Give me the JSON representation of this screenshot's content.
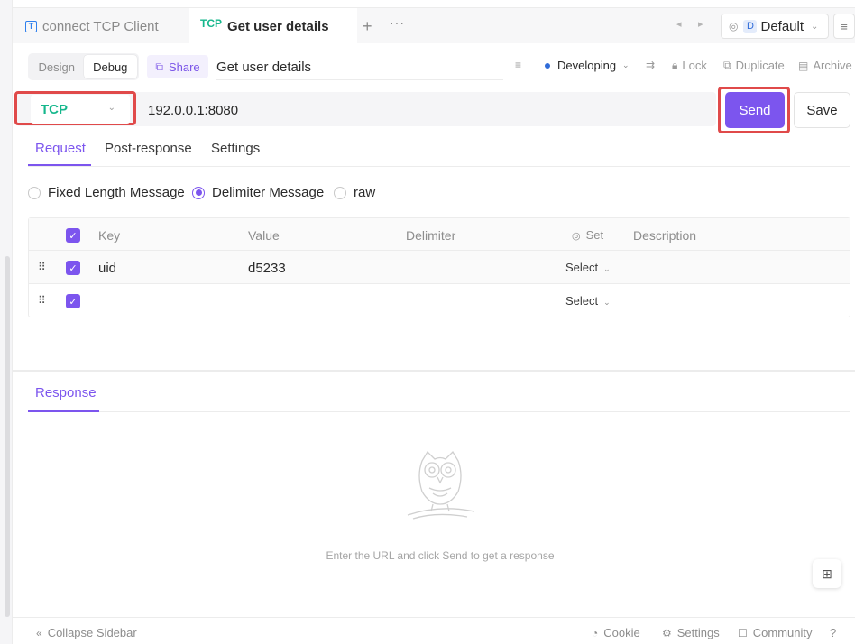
{
  "tabs": [
    {
      "label": "connect TCP Client",
      "icon": "t-icon"
    },
    {
      "tag": "TCP",
      "label": "Get user details"
    }
  ],
  "tabbar": {
    "add": "+",
    "more": "···",
    "prev": "◂",
    "next": "▸"
  },
  "environment": {
    "badge": "D",
    "label": "Default"
  },
  "mode": {
    "design": "Design",
    "debug": "Debug"
  },
  "share_label": "Share",
  "request_name": "Get user details",
  "toolbar": {
    "status": "Developing",
    "lock": "Lock",
    "duplicate": "Duplicate",
    "archive": "Archive"
  },
  "method": "TCP",
  "url": "192.0.0.1:8080",
  "send_label": "Send",
  "save_label": "Save",
  "request_tabs": [
    "Request",
    "Post-response",
    "Settings"
  ],
  "message_types": [
    {
      "label": "Fixed Length Message",
      "selected": false
    },
    {
      "label": "Delimiter Message",
      "selected": true
    },
    {
      "label": "raw",
      "selected": false
    }
  ],
  "table": {
    "headers": {
      "key": "Key",
      "value": "Value",
      "delimiter": "Delimiter",
      "set": "Set",
      "description": "Description"
    },
    "rows": [
      {
        "key": "uid",
        "value": "d5233",
        "set": "Select"
      },
      {
        "key": "",
        "value": "",
        "set": "Select"
      }
    ]
  },
  "response": {
    "tab": "Response",
    "empty_text": "Enter the URL and click Send to get a response"
  },
  "footer": {
    "collapse": "Collapse Sidebar",
    "cookie": "Cookie",
    "settings": "Settings",
    "community": "Community"
  },
  "colors": {
    "accent": "#7c55ee",
    "tcp": "#15b78c",
    "highlight": "#e04a4a"
  }
}
